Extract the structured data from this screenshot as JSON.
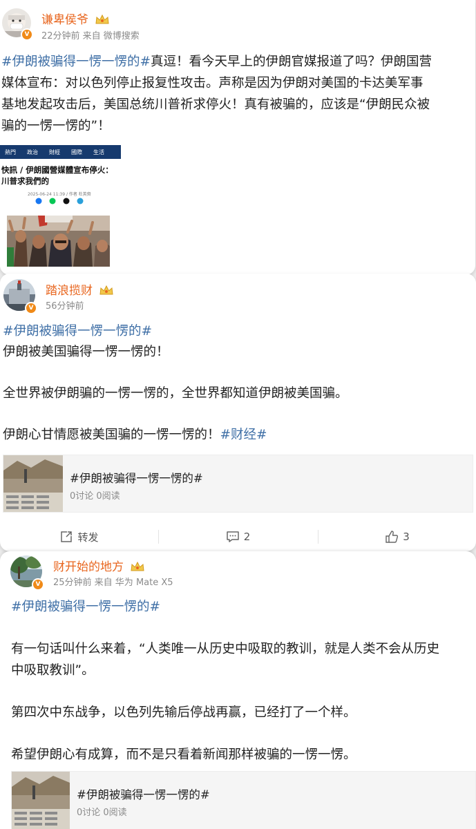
{
  "posts": [
    {
      "username": "谦卑侯爷",
      "meta": "22分钟前 来自 微博搜索",
      "text_lines": [
        [
          {
            "t": "#伊朗被骗得一愣一愣的#",
            "tag": true
          },
          {
            "t": "真逗！看今天早上的伊朗官媒报道了吗？伊朗国营",
            "tag": false
          }
        ],
        [
          {
            "t": "媒体宣布：对以色列停止报复性攻击。声称是因为伊朗对美国的卡达美军事",
            "tag": false
          }
        ],
        [
          {
            "t": "基地发起攻击后，美国总统川普祈求停火！真有被骗的，应该是“伊朗民众被",
            "tag": false
          }
        ],
        [
          {
            "t": "骗的一愣一愣的”！",
            "tag": false
          }
        ]
      ],
      "embedded_image": {
        "nav": [
          "熱門",
          "政治",
          "財經",
          "國際",
          "生活"
        ],
        "headline_lines": [
          "快訊 / 伊朗國營媒體宣布停火：",
          "川普求我們的"
        ],
        "dateline": "2025-06-24 11:39 / 作者 杜英齊",
        "share_icons": [
          "facebook-icon",
          "line-icon",
          "x-icon",
          "telegram-icon"
        ],
        "share_colors": [
          "#1877f2",
          "#06c755",
          "#111111",
          "#2aa0da"
        ]
      }
    },
    {
      "username": "踏浪揽财",
      "meta": "56分钟前",
      "text_lines": [
        [
          {
            "t": "#伊朗被骗得一愣一愣的#",
            "tag": true
          }
        ],
        [
          {
            "t": "伊朗被美国骗得一愣一愣的！",
            "tag": false
          }
        ],
        [],
        [
          {
            "t": "全世界被伊朗骗的一愣一愣的，全世界都知道伊朗被美国骗。",
            "tag": false
          }
        ],
        [],
        [
          {
            "t": "伊朗心甘情愿被美国骗的一愣一愣的！",
            "tag": false
          },
          {
            "t": "#财经#",
            "tag": true
          }
        ]
      ],
      "link_card": {
        "title": "#伊朗被骗得一愣一愣的#",
        "stats": "0讨论 0阅读"
      },
      "actions": {
        "repost": "转发",
        "comments": "2",
        "likes": "3"
      }
    },
    {
      "username": "财开始的地方",
      "meta": "25分钟前 来自 华为 Mate X5",
      "text_lines": [
        [
          {
            "t": "#伊朗被骗得一愣一愣的#",
            "tag": true
          }
        ],
        [],
        [
          {
            "t": "有一句话叫什么来着，“人类唯一从历史中吸取的教训，就是人类不会从历史",
            "tag": false
          }
        ],
        [
          {
            "t": "中吸取教训”。",
            "tag": false
          }
        ],
        [],
        [
          {
            "t": "第四次中东战争，以色列先输后停战再赢，已经打了一个样。",
            "tag": false
          }
        ],
        [],
        [
          {
            "t": "希望伊朗心有成算，而不是只看着新闻那样被骗的一愣一愣。",
            "tag": false
          }
        ]
      ],
      "link_card": {
        "title": "#伊朗被骗得一愣一愣的#",
        "stats": "0讨论 0阅读"
      }
    }
  ],
  "colors": {
    "username": "#e8661f",
    "hashtag": "#3f6fa6",
    "meta": "#8a8a8a",
    "verified_badge": "#f08a18"
  }
}
